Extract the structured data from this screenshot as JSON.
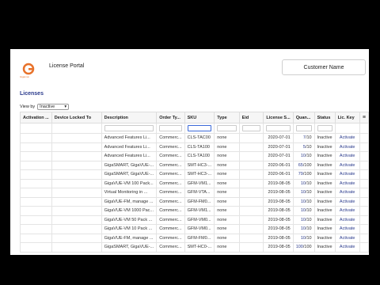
{
  "header": {
    "portal_title": "License Portal",
    "logo_text": "Gigamon",
    "customer_button": "Customer Name"
  },
  "section": {
    "title": "Licenses",
    "view_by_label": "View by",
    "view_by_value": "Inactive"
  },
  "table": {
    "columns": [
      "Activation ...",
      "Device Locked To",
      "Description",
      "Order Ty...",
      "SKU",
      "Type",
      "Eid",
      "License S...",
      "Quan...",
      "Status",
      "Lic. Key"
    ],
    "rows": [
      {
        "desc": "Advanced Features Li...",
        "order": "Commerc...",
        "sku": "CLS-TAC00",
        "type": "none",
        "eid": "",
        "start": "2020-07-01",
        "qa": "7",
        "qb": "10",
        "status": "Inactive",
        "action": "Activate"
      },
      {
        "desc": "Advanced Features Li...",
        "order": "Commerc...",
        "sku": "CLS-TA100",
        "type": "none",
        "eid": "",
        "start": "2020-07-01",
        "qa": "5",
        "qb": "10",
        "status": "Inactive",
        "action": "Activate"
      },
      {
        "desc": "Advanced Features Li...",
        "order": "Commerc...",
        "sku": "CLS-TA100",
        "type": "none",
        "eid": "",
        "start": "2020-07-01",
        "qa": "10",
        "qb": "10",
        "status": "Inactive",
        "action": "Activate"
      },
      {
        "desc": "GigaSMART, GigaVUE-...",
        "order": "Commerc...",
        "sku": "SMT-HC3-...",
        "type": "none",
        "eid": "",
        "start": "2020-06-01",
        "qa": "65",
        "qb": "100",
        "status": "Inactive",
        "action": "Activate"
      },
      {
        "desc": "GigaSMART, GigaVUE-...",
        "order": "Commerc...",
        "sku": "SMT-HC3-...",
        "type": "none",
        "eid": "",
        "start": "2020-06-01",
        "qa": "79",
        "qb": "100",
        "status": "Inactive",
        "action": "Activate"
      },
      {
        "desc": "GigaVUE-VM 100 Pack...",
        "order": "Commerc...",
        "sku": "GFM-VM1...",
        "type": "none",
        "eid": "",
        "start": "2019-08-05",
        "qa": "10",
        "qb": "10",
        "status": "Inactive",
        "action": "Activate"
      },
      {
        "desc": "Virtual Monitoring in ...",
        "order": "Commerc...",
        "sku": "GFM-VTA...",
        "type": "none",
        "eid": "",
        "start": "2019-08-05",
        "qa": "10",
        "qb": "10",
        "status": "Inactive",
        "action": "Activate"
      },
      {
        "desc": "GigaVUE-FM, manage ...",
        "order": "Commerc...",
        "sku": "GFM-FM0...",
        "type": "none",
        "eid": "",
        "start": "2019-08-05",
        "qa": "10",
        "qb": "10",
        "status": "Inactive",
        "action": "Activate"
      },
      {
        "desc": "GigaVUE-VM 1000 Pac...",
        "order": "Commerc...",
        "sku": "GFM-VM1...",
        "type": "none",
        "eid": "",
        "start": "2019-08-05",
        "qa": "10",
        "qb": "10",
        "status": "Inactive",
        "action": "Activate"
      },
      {
        "desc": "GigaVUE-VM 50 Pack ...",
        "order": "Commerc...",
        "sku": "GFM-VM0...",
        "type": "none",
        "eid": "",
        "start": "2019-08-05",
        "qa": "10",
        "qb": "10",
        "status": "Inactive",
        "action": "Activate"
      },
      {
        "desc": "GigaVUE-VM 10 Pack ...",
        "order": "Commerc...",
        "sku": "GFM-VM0...",
        "type": "none",
        "eid": "",
        "start": "2019-08-05",
        "qa": "10",
        "qb": "10",
        "status": "Inactive",
        "action": "Activate"
      },
      {
        "desc": "GigaVUE-FM, manage ...",
        "order": "Commerc...",
        "sku": "GFM-FM0...",
        "type": "none",
        "eid": "",
        "start": "2019-08-05",
        "qa": "10",
        "qb": "10",
        "status": "Inactive",
        "action": "Activate"
      },
      {
        "desc": "GigaSMART, GigaVUE-...",
        "order": "Commerc...",
        "sku": "SMT-HC0-...",
        "type": "none",
        "eid": "",
        "start": "2019-08-05",
        "qa": "100",
        "qb": "100",
        "status": "Inactive",
        "action": "Activate"
      }
    ]
  },
  "colors": {
    "accent": "#2a3a8c",
    "brand": "#e8722a"
  }
}
